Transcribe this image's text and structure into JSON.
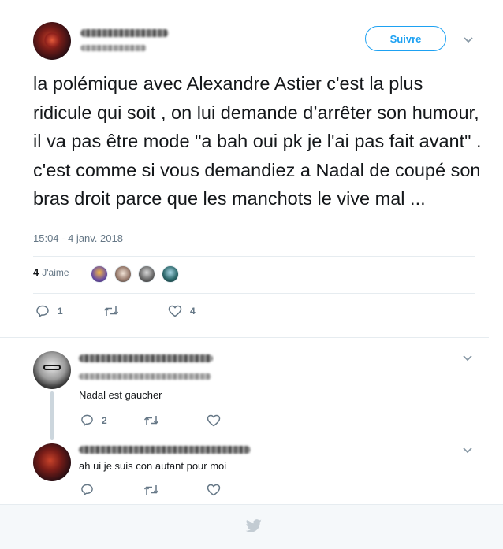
{
  "tweet": {
    "follow_label": "Suivre",
    "text": "la polémique avec Alexandre Astier c'est la plus ridicule qui soit , on lui demande d’arrêter son humour, il va pas être mode \"a bah oui pk je l'ai pas fait avant\" . c'est comme si vous demandiez a Nadal de coupé son bras droit parce que les manchots le vive mal ...",
    "timestamp": "15:04 - 4 janv. 2018",
    "likes_count": "4",
    "likes_label": "J'aime",
    "reply_count": "1",
    "retweet_count": "",
    "like_count": "4"
  },
  "replies": [
    {
      "text": "Nadal est gaucher",
      "reply_count": "2",
      "retweet_count": "",
      "like_count": ""
    },
    {
      "text": "ah ui je suis con autant pour moi",
      "reply_count": "",
      "retweet_count": "",
      "like_count": ""
    }
  ],
  "colors": {
    "accent": "#1da1f2",
    "muted": "#657786",
    "text": "#14171a",
    "thread_line": "#ccd6dd"
  }
}
